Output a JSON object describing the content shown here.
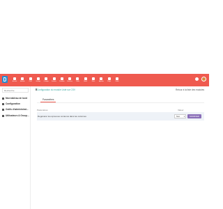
{
  "nav": {
    "items": [
      {
        "label": "Accueil",
        "icon": "home-icon"
      },
      {
        "label": "Activité",
        "icon": "activity-icon"
      },
      {
        "label": "Outil",
        "icon": "tool-icon"
      },
      {
        "label": "Groupe",
        "icon": "group-icon"
      },
      {
        "label": "Compta",
        "icon": "accounting-icon"
      },
      {
        "label": "Facture",
        "icon": "invoice-icon"
      },
      {
        "label": "Produits",
        "icon": "product-icon"
      },
      {
        "label": "Services",
        "icon": "services-icon"
      },
      {
        "label": "Outils",
        "icon": "tools-icon"
      },
      {
        "label": "Stock",
        "icon": "stock-icon"
      },
      {
        "label": "Docs",
        "icon": "docs-icon"
      },
      {
        "label": "Agenda",
        "icon": "agenda-icon"
      },
      {
        "label": "Projet",
        "icon": "project-icon"
      },
      {
        "label": "Outils",
        "icon": "wrench-icon"
      }
    ]
  },
  "sidebar": {
    "search_placeholder": "Recherche",
    "items": [
      {
        "label": "Mon tableau de bord",
        "icon": "dashboard-icon"
      },
      {
        "label": "Configuration",
        "icon": "config-icon"
      },
      {
        "label": "Outils d'administrat...",
        "icon": "admin-tools-icon"
      },
      {
        "label": "Utilisateurs & Group...",
        "icon": "users-icon"
      }
    ]
  },
  "main": {
    "breadcrumb": "Configuration du module Liste sur CSV",
    "header_link": "Retour à la liste des modules",
    "tab": "Paramètres",
    "table": {
      "col_param": "Paramètres",
      "col_value": "Valeur",
      "row_label": "Regénérer les épreuves contenus dans les colonnes",
      "select_value": "Non",
      "save_label": "MODIFIER"
    }
  },
  "colors": {
    "topbar": "#ef5a4f",
    "accent": "#3aa7a0",
    "button": "#8a6fb8"
  }
}
